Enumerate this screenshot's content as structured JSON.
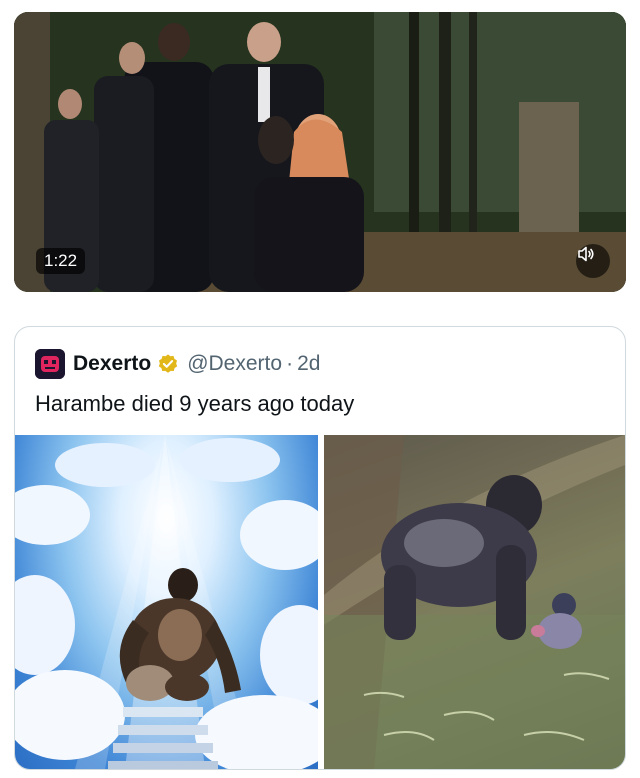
{
  "video": {
    "duration": "1:22",
    "mute_icon": "speaker-muted-icon"
  },
  "quoted_tweet": {
    "author_name": "Dexerto",
    "author_handle": "@Dexerto",
    "separator": "·",
    "time_ago": "2d",
    "verified_badge_color": "#e2b719",
    "text": "Harambe died 9 years ago today",
    "media": [
      {
        "description_icon": "gorilla-heaven-image"
      },
      {
        "description_icon": "gorilla-enclosure-image"
      }
    ]
  },
  "colors": {
    "text_primary": "#0f1419",
    "text_secondary": "#536471",
    "border": "#cfd9de"
  }
}
